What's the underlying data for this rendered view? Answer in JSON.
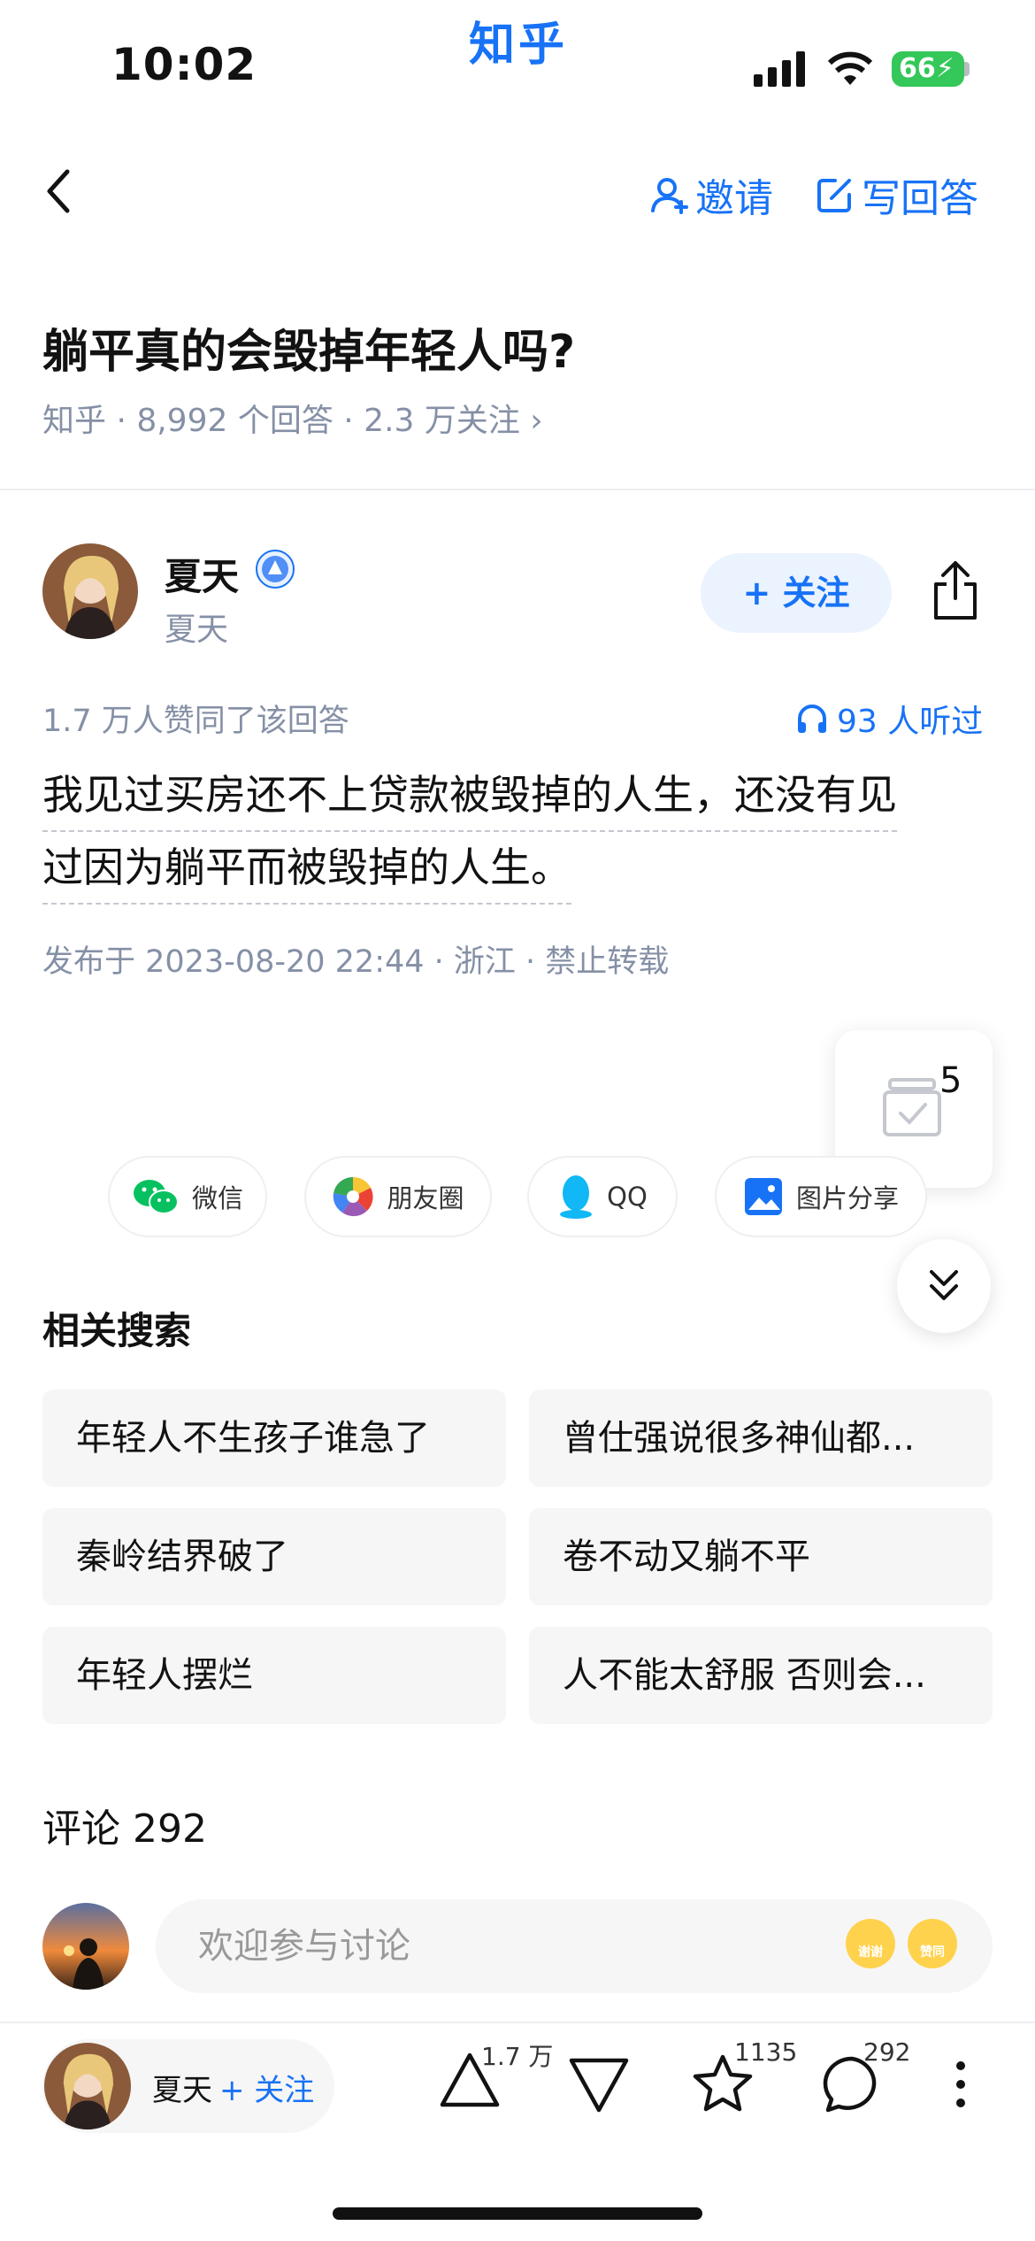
{
  "status_bar": {
    "time": "10:02",
    "app_label": "知乎",
    "battery": "66"
  },
  "nav": {
    "invite_label": "邀请",
    "write_answer_label": "写回答"
  },
  "question": {
    "title": "躺平真的会毁掉年轻人吗?",
    "meta": "知乎 · 8,992 个回答 · 2.3 万关注 ›"
  },
  "author": {
    "name": "夏天",
    "subtitle": "夏天",
    "follow_label": "+ 关注"
  },
  "answer": {
    "likes_text": "1.7 万人赞同了该回答",
    "listen_text": "93 人听过",
    "lines": [
      "我见过买房还不上贷款被毁掉的人生，还没有见",
      "过因为躺平而被毁掉的人生。"
    ],
    "meta": "发布于 2023-08-20 22:44 · 浙江 · 禁止转载"
  },
  "float_card": {
    "count": "5"
  },
  "share": {
    "wechat": "微信",
    "moments": "朋友圈",
    "qq": "QQ",
    "image": "图片分享"
  },
  "related": {
    "title": "相关搜索",
    "items": [
      "年轻人不生孩子谁急了",
      "曾仕强说很多神仙都...",
      "秦岭结界破了",
      "卷不动又躺不平",
      "年轻人摆烂",
      "人不能太舒服 否则会..."
    ]
  },
  "comments": {
    "title": "评论 292",
    "placeholder": "欢迎参与讨论",
    "emoji_1": "谢谢",
    "emoji_2": "赞同"
  },
  "bottom_bar": {
    "author_name": "夏天",
    "follow_label": "+ 关注",
    "upvote_count": "1.7 万",
    "favorite_count": "1135",
    "comment_count": "292"
  },
  "colors": {
    "accent": "#1772f6",
    "meta_gray": "#8590a6",
    "chip_bg": "#f6f6f6"
  }
}
